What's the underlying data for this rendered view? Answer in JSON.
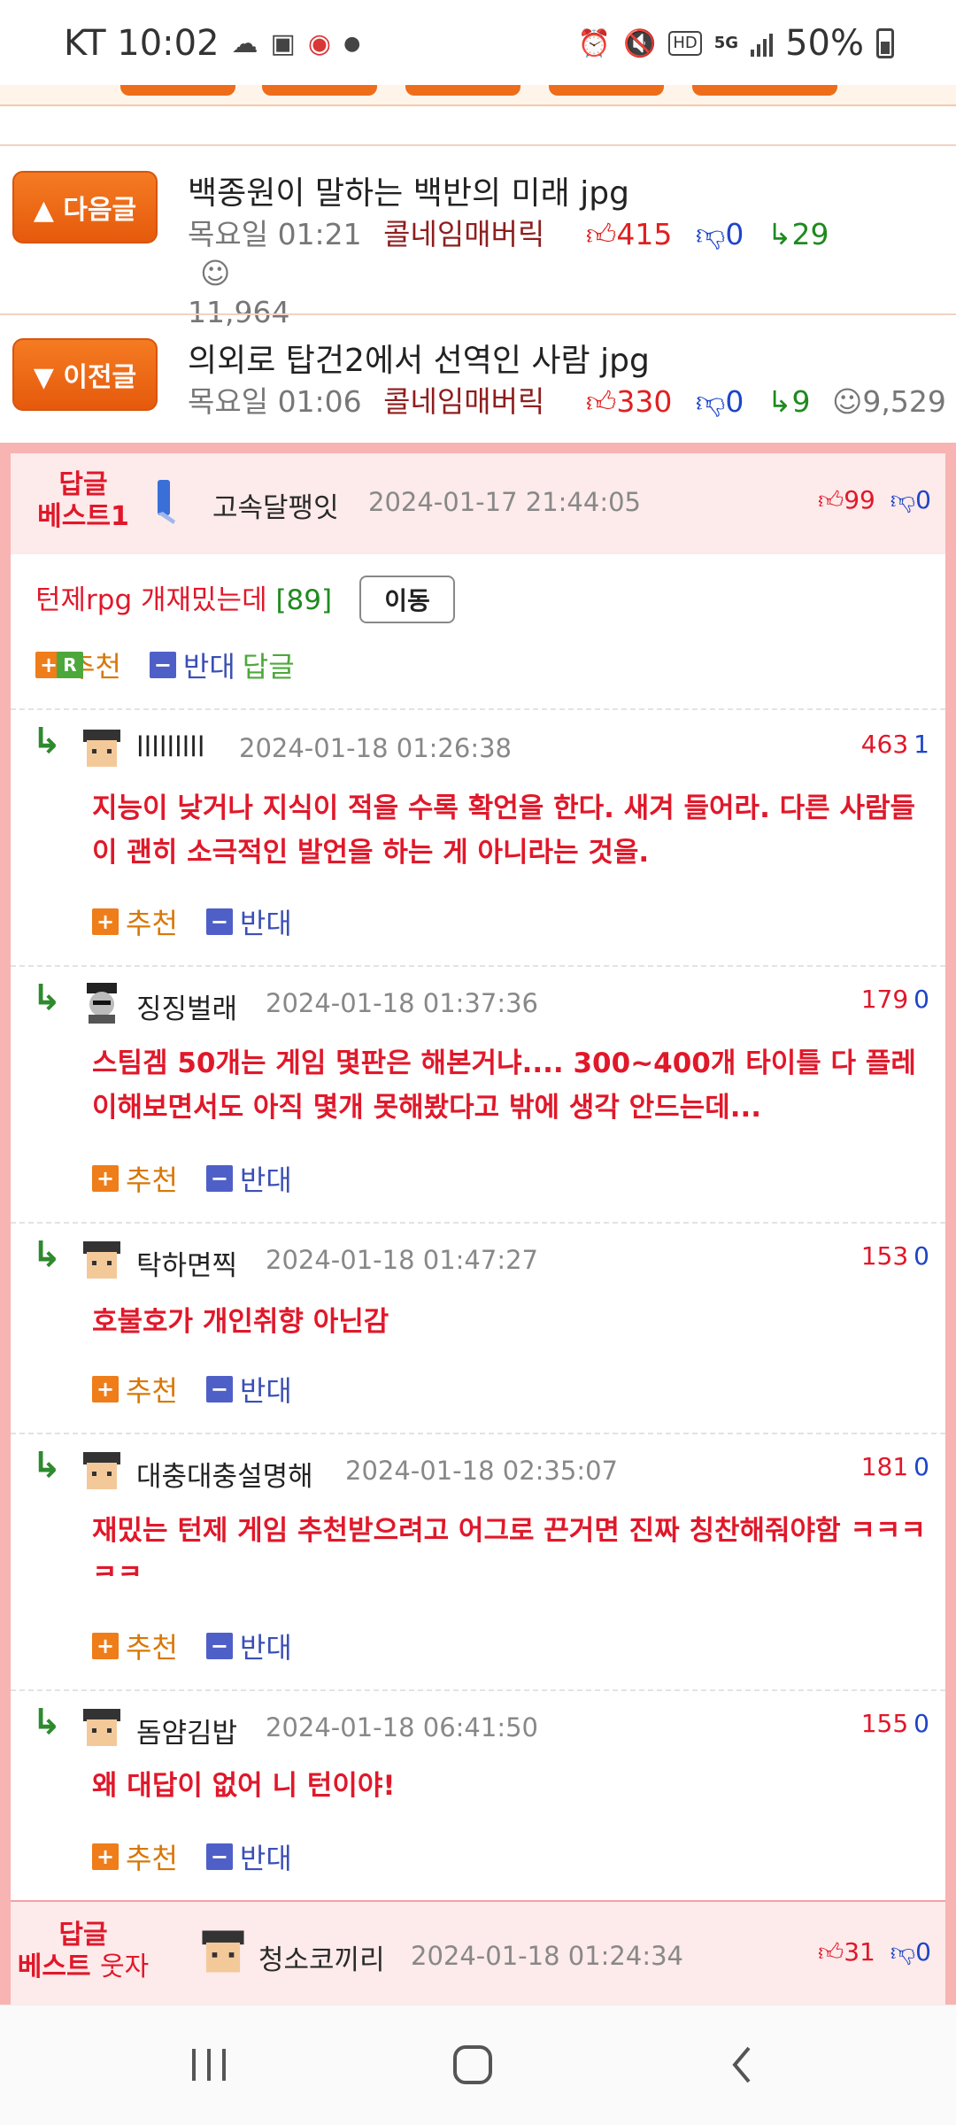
{
  "status_bar": {
    "carrier_time": "KT 10:02",
    "hd": "HD",
    "network": "5G",
    "battery": "50%"
  },
  "next_post": {
    "button_label": "▲ 다음글",
    "title": "백종원이 말하는 백반의 미래 jpg",
    "date": "목요일 01:21",
    "author": "콜네임매버릭",
    "upvotes": "415",
    "downvotes": "0",
    "replies": "29",
    "views": "11,964"
  },
  "prev_post": {
    "button_label": "▼ 이전글",
    "title": "의외로 탑건2에서 선역인 사람 jpg",
    "date": "목요일 01:06",
    "author": "콜네임매버릭",
    "upvotes": "330",
    "downvotes": "0",
    "replies": "9",
    "views": "9,529"
  },
  "best_comment": {
    "label_line1": "답글",
    "label_line2": "베스트1",
    "author": "고속달팽잇",
    "date": "2024-01-17 21:44:05",
    "upvotes": "99",
    "downvotes": "0",
    "text": "턴제rpg 개재밌는데 ",
    "count": "[89]",
    "move_label": "이동",
    "recommend_label": "추천",
    "oppose_label": "반대",
    "reply_label": "답글"
  },
  "replies": [
    {
      "author": "lllllllll",
      "date": "2024-01-18 01:26:38",
      "up": "463",
      "down": "1",
      "text": "지능이 낮거나 지식이 적을 수록 확언을 한다. 새겨 들어라. 다른 사람들이 괜히 소극적인 발언을 하는 게 아니라는 것을.",
      "recommend": "추천",
      "oppose": "반대"
    },
    {
      "author": "징징벌래",
      "date": "2024-01-18 01:37:36",
      "up": "179",
      "down": "0",
      "text": "스팀겜 50개는 게임 몇판은 해본거냐.... 300~400개 타이틀 다 플레이해보면서도 아직 몇개 못해봤다고 밖에 생각 안드는데...",
      "recommend": "추천",
      "oppose": "반대"
    },
    {
      "author": "탁하면찍",
      "date": "2024-01-18 01:47:27",
      "up": "153",
      "down": "0",
      "text": "호불호가 개인취향 아닌감",
      "recommend": "추천",
      "oppose": "반대"
    },
    {
      "author": "대충대충설명해",
      "date": "2024-01-18 02:35:07",
      "up": "181",
      "down": "0",
      "text": "재밌는 턴제 게임 추천받으려고 어그로 끈거면 진짜 칭찬해줘야함 ㅋㅋㅋㅋㅋ",
      "recommend": "추천",
      "oppose": "반대"
    },
    {
      "author": "돔얌김밥",
      "date": "2024-01-18 06:41:50",
      "up": "155",
      "down": "0",
      "text": "왜 대답이 없어 니 턴이야!",
      "recommend": "추천",
      "oppose": "반대"
    }
  ],
  "best_funny": {
    "label_line1": "답글",
    "label_line2a": "베스트",
    "label_line2b": "웃자",
    "author": "청소코끼리",
    "date": "2024-01-18 01:24:34",
    "upvotes": "31",
    "downvotes": "0"
  },
  "colors": {
    "accent": "#ee6d1a",
    "best_bg": "#fdeaea",
    "border_pink": "#f8b3b3",
    "text_red": "#e0182a",
    "vote_blue": "#1d45c8"
  }
}
